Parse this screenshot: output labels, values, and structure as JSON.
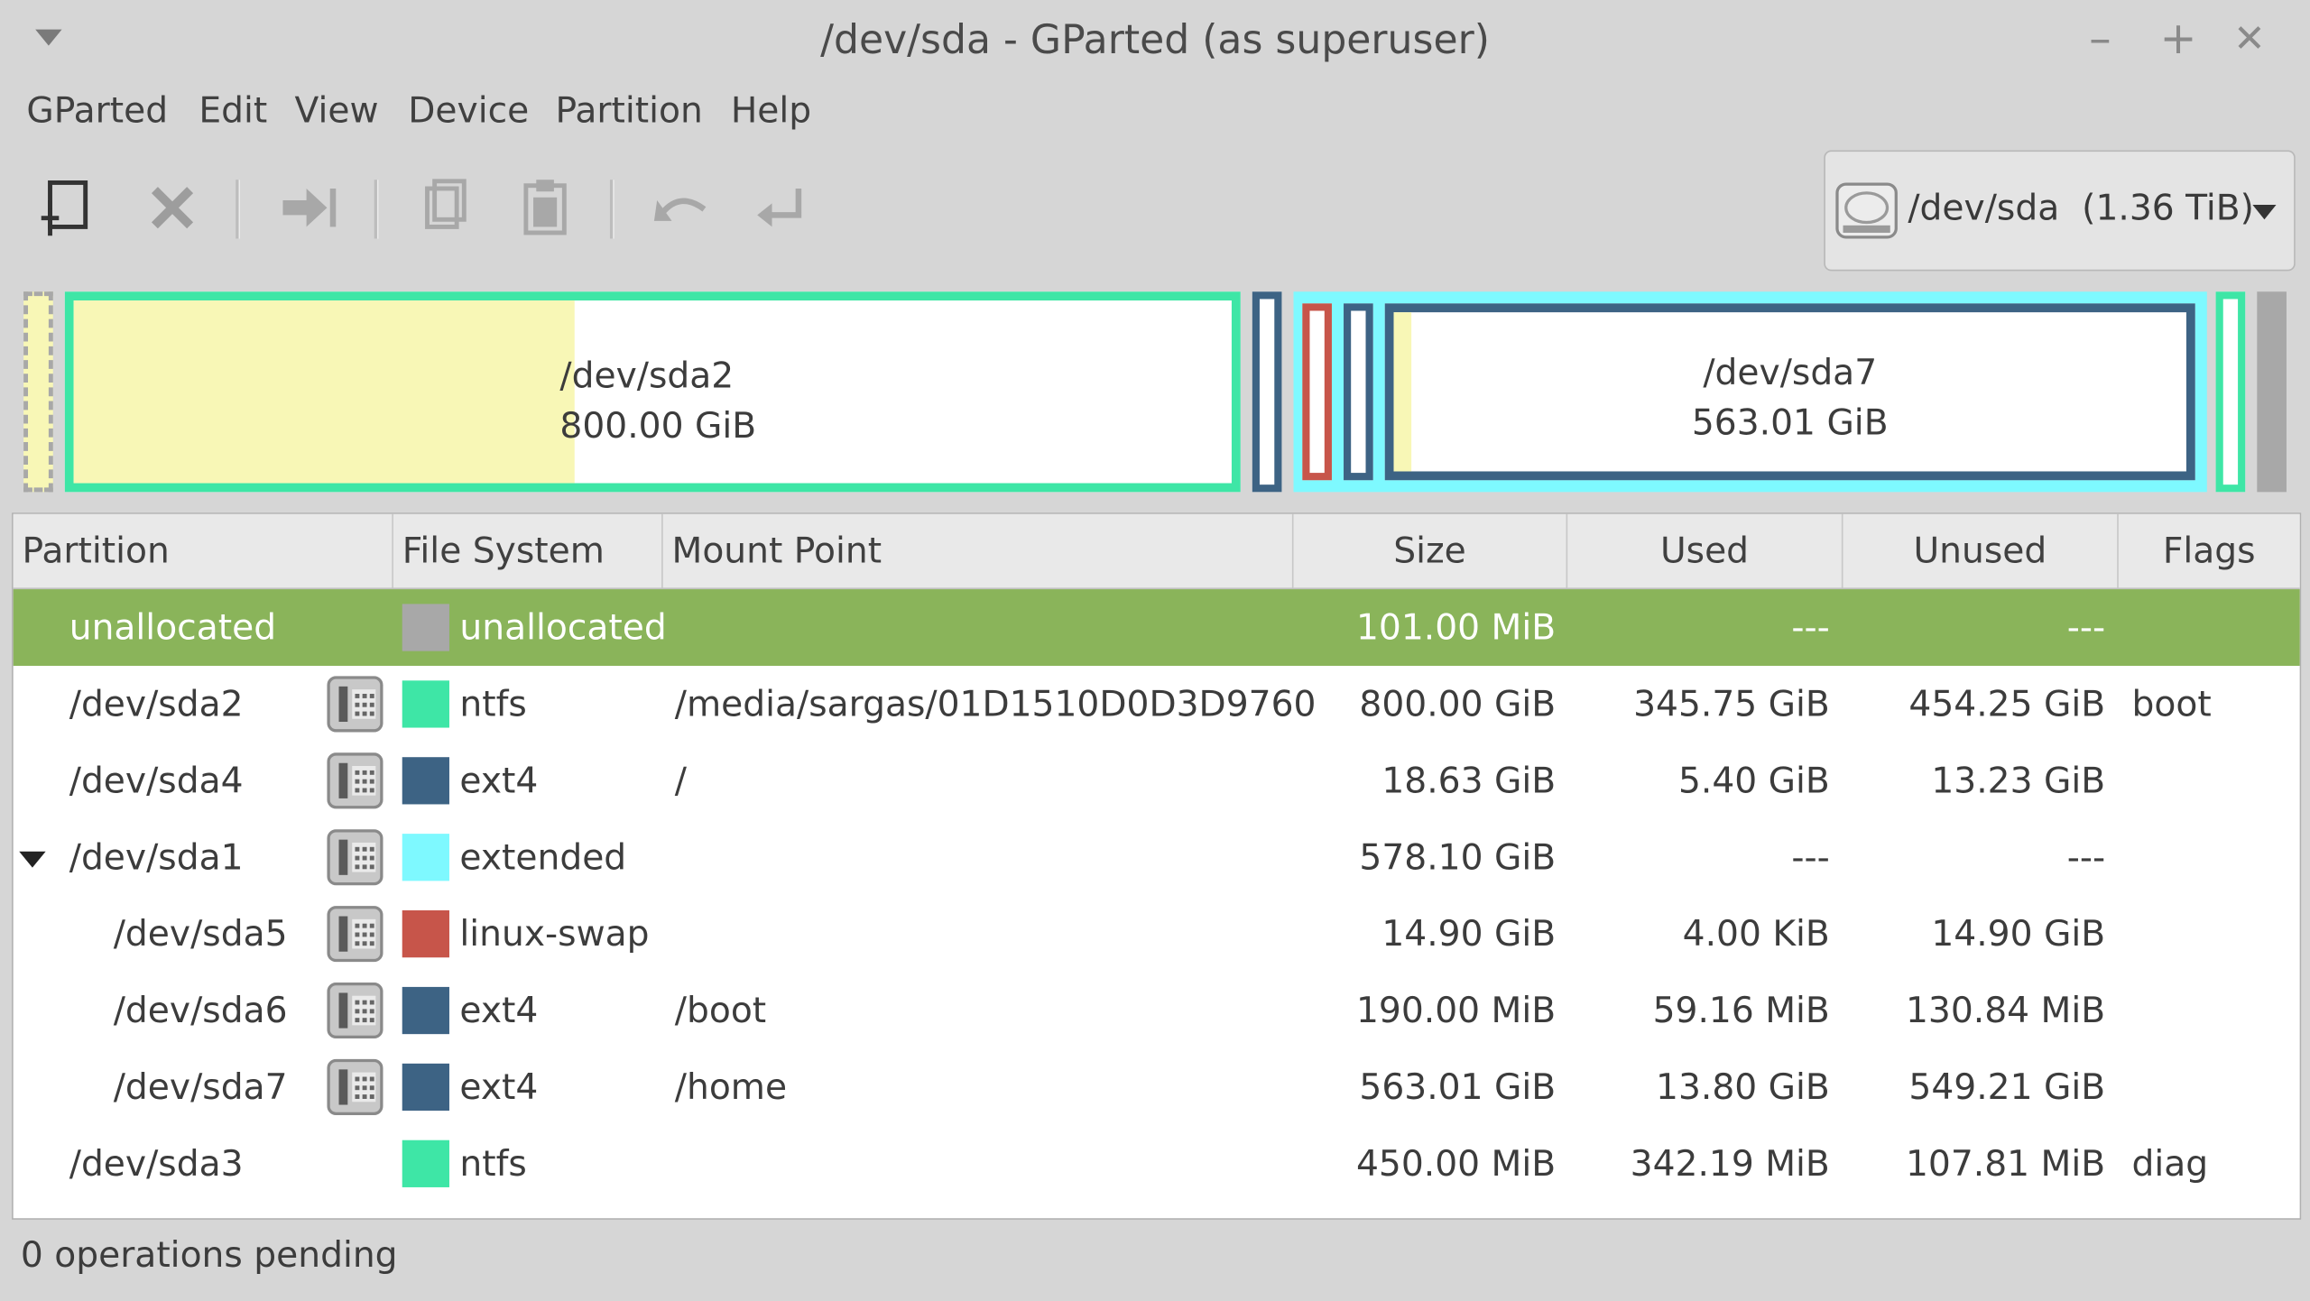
{
  "window": {
    "title": "/dev/sda - GParted (as superuser)",
    "minimize": "–",
    "maximize": "+",
    "close": "✕"
  },
  "menubar": [
    "GParted",
    "Edit",
    "View",
    "Device",
    "Partition",
    "Help"
  ],
  "toolbar": {
    "icons": [
      "new-partition-icon",
      "delete-icon",
      "resize-move-icon",
      "copy-icon",
      "paste-icon",
      "undo-icon",
      "apply-icon"
    ]
  },
  "device": {
    "name": "/dev/sda",
    "size": "(1.36 TiB)"
  },
  "map": {
    "sda2": {
      "name": "/dev/sda2",
      "size": "800.00 GiB"
    },
    "sda7": {
      "name": "/dev/sda7",
      "size": "563.01 GiB"
    }
  },
  "colors": {
    "ntfs": "#3ee6a6",
    "ext4": "#3d6384",
    "extended": "#7ef9ff",
    "linux_swap": "#c7554a",
    "unallocated": "#a8a8a8",
    "used": "#f8f7b6",
    "selected_row": "#8ab45a"
  },
  "table": {
    "headers": [
      "Partition",
      "File System",
      "Mount Point",
      "Size",
      "Used",
      "Unused",
      "Flags"
    ],
    "rows": [
      {
        "partition": "unallocated",
        "fs": "unallocated",
        "fs_color": "#a8a8a8",
        "mount": "",
        "size": "101.00 MiB",
        "used": "---",
        "unused": "---",
        "flags": "",
        "selected": true,
        "indent": 0,
        "lock": false
      },
      {
        "partition": "/dev/sda2",
        "fs": "ntfs",
        "fs_color": "#3ee6a6",
        "mount": "/media/sargas/01D1510D0D3D9760",
        "size": "800.00 GiB",
        "used": "345.75 GiB",
        "unused": "454.25 GiB",
        "flags": "boot",
        "indent": 0,
        "lock": true
      },
      {
        "partition": "/dev/sda4",
        "fs": "ext4",
        "fs_color": "#3d6384",
        "mount": "/",
        "size": "18.63 GiB",
        "used": "5.40 GiB",
        "unused": "13.23 GiB",
        "flags": "",
        "indent": 0,
        "lock": true
      },
      {
        "partition": "/dev/sda1",
        "fs": "extended",
        "fs_color": "#7ef9ff",
        "mount": "",
        "size": "578.10 GiB",
        "used": "---",
        "unused": "---",
        "flags": "",
        "indent": 0,
        "lock": true,
        "expander": true
      },
      {
        "partition": "/dev/sda5",
        "fs": "linux-swap",
        "fs_color": "#c7554a",
        "mount": "",
        "size": "14.90 GiB",
        "used": "4.00 KiB",
        "unused": "14.90 GiB",
        "flags": "",
        "indent": 1,
        "lock": true
      },
      {
        "partition": "/dev/sda6",
        "fs": "ext4",
        "fs_color": "#3d6384",
        "mount": "/boot",
        "size": "190.00 MiB",
        "used": "59.16 MiB",
        "unused": "130.84 MiB",
        "flags": "",
        "indent": 1,
        "lock": true
      },
      {
        "partition": "/dev/sda7",
        "fs": "ext4",
        "fs_color": "#3d6384",
        "mount": "/home",
        "size": "563.01 GiB",
        "used": "13.80 GiB",
        "unused": "549.21 GiB",
        "flags": "",
        "indent": 1,
        "lock": true
      },
      {
        "partition": "/dev/sda3",
        "fs": "ntfs",
        "fs_color": "#3ee6a6",
        "mount": "",
        "size": "450.00 MiB",
        "used": "342.19 MiB",
        "unused": "107.81 MiB",
        "flags": "diag",
        "indent": 0,
        "lock": false
      }
    ]
  },
  "status": "0 operations pending"
}
